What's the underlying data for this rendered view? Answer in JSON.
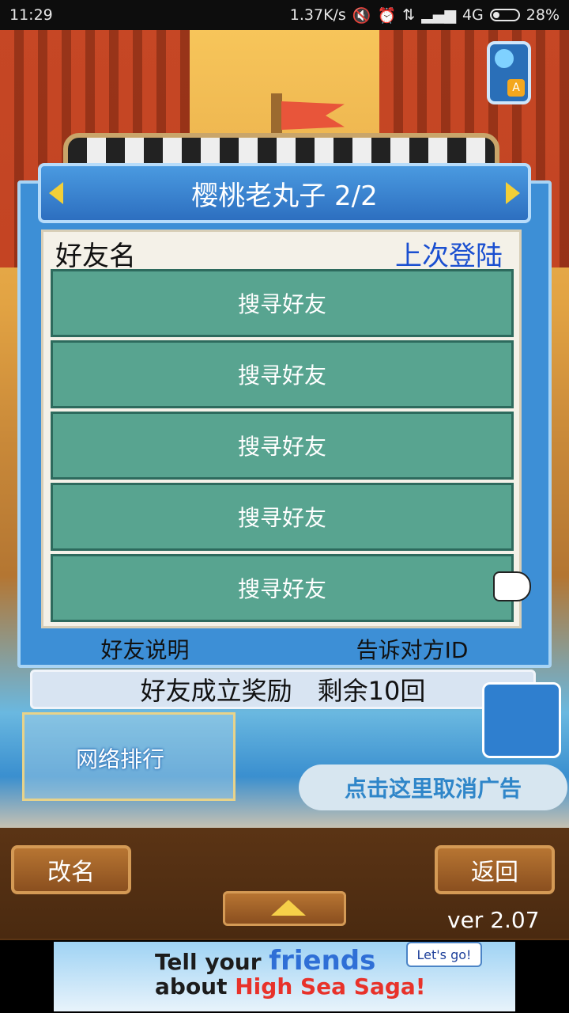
{
  "status_bar": {
    "time": "11:29",
    "speed": "1.37K/s",
    "network": "4G",
    "battery": "28%"
  },
  "dialog": {
    "title": "樱桃老丸子 2/2",
    "header_left": "好友名",
    "header_right": "上次登陆",
    "rows": [
      {
        "label": "搜寻好友"
      },
      {
        "label": "搜寻好友"
      },
      {
        "label": "搜寻好友"
      },
      {
        "label": "搜寻好友"
      },
      {
        "label": "搜寻好友"
      }
    ],
    "footer_left": "好友说明",
    "footer_right": "告诉对方ID",
    "reward_text": "好友成立奖励　剩余10回"
  },
  "scene": {
    "ranking_label": "网络排行",
    "cancel_ad_label": "点击这里取消广告"
  },
  "bottom": {
    "rename_label": "改名",
    "back_label": "返回",
    "version": "ver 2.07",
    "lang_badge": "A"
  },
  "ad": {
    "line1_pre": "Tell your ",
    "line1_hl": "friends",
    "line2_pre": "about ",
    "line2_hl": "High Sea Saga!",
    "button": "Let's go!",
    "highlight_colors": [
      "#2f6fd6",
      "#e8322a"
    ]
  }
}
